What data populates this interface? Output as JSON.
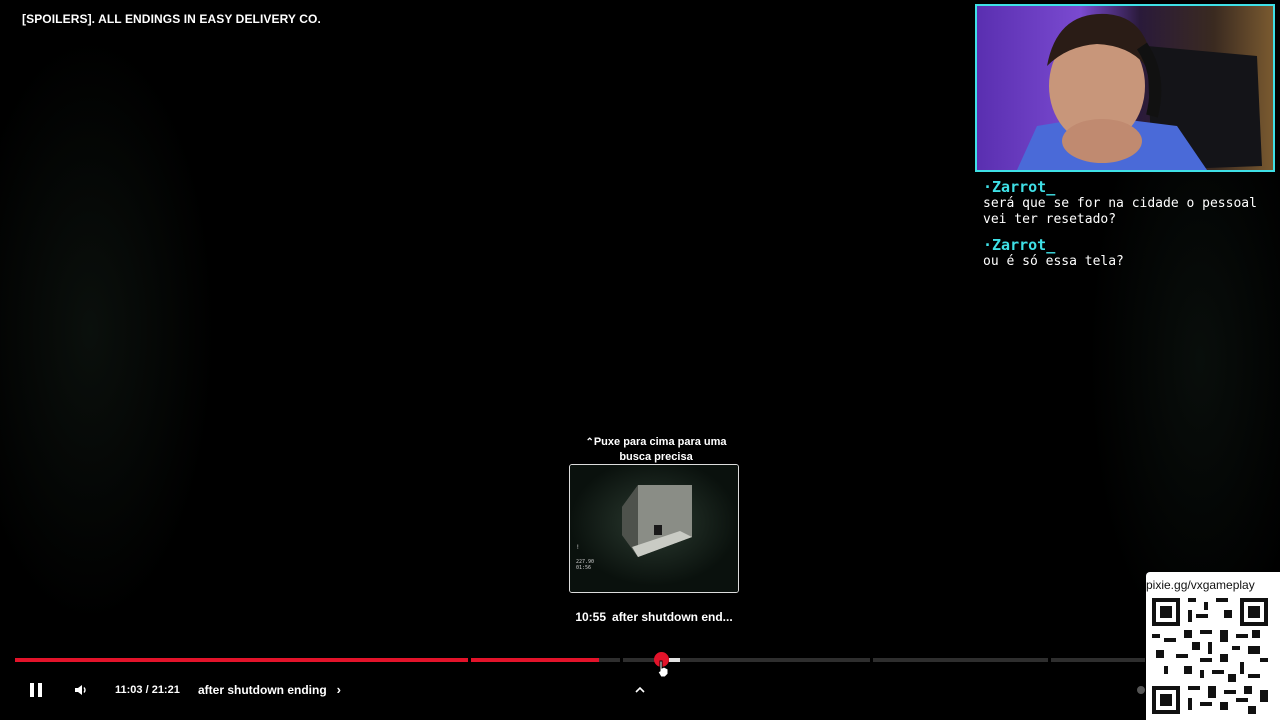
{
  "video": {
    "title": "[SPOILERS]. ALL ENDINGS IN EASY DELIVERY CO."
  },
  "chat": {
    "messages": [
      {
        "user": "·Zarrot_",
        "text": "será que se for na cidade o pessoal vei ter resetado?"
      },
      {
        "user": "·Zarrot_",
        "text": "ou é só essa tela?"
      }
    ]
  },
  "seek_preview": {
    "hint_icon": "double-chevron-up-icon",
    "hint": "Puxe para cima para uma busca precisa",
    "timestamp": "10:55",
    "chapter": "after shutdown end..."
  },
  "player": {
    "current_time": "11:03",
    "duration": "21:21",
    "time_display": "11:03 / 21:21",
    "chapter_title": "after shutdown ending",
    "played_fraction": 0.517,
    "accent_color": "#e3132a"
  },
  "overlay": {
    "qr_url": "pixie.gg/vxgameplay"
  },
  "icons": {
    "pause": "pause-icon",
    "volume": "volume-icon",
    "chapter_next": "chevron-right-icon",
    "expand": "chevron-up-icon"
  }
}
